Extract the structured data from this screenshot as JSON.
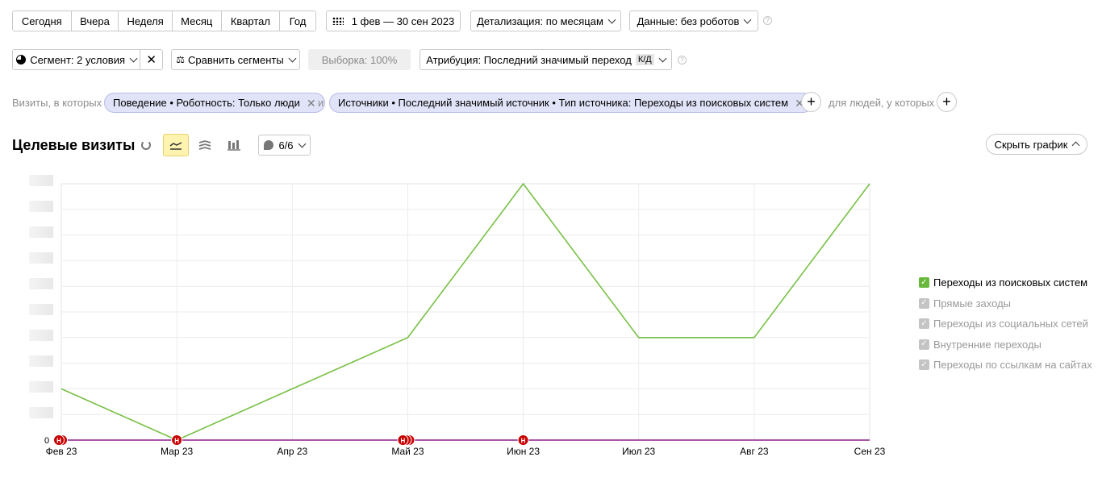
{
  "toolbar": {
    "periods": [
      "Сегодня",
      "Вчера",
      "Неделя",
      "Месяц",
      "Квартал",
      "Год"
    ],
    "date_range": "1 фев — 30 сен 2023",
    "detail": "Детализация: по месяцам",
    "data_filter": "Данные: без роботов",
    "help": "?"
  },
  "row2": {
    "segment": "Сегмент: 2 условия",
    "compare": "Сравнить сегменты",
    "sample": "Выборка: 100%",
    "attribution": "Атрибуция: Последний значимый переход",
    "attribution_badge": "К/Д"
  },
  "filters": {
    "prefix": "Визиты, в которых",
    "cond1": "Поведение • Роботность: Только люди",
    "joiner": "и",
    "cond2": "Источники • Последний значимый источник • Тип источника: Переходы из поисковых систем",
    "people": "для людей, у которых"
  },
  "chart_header": {
    "title": "Целевые визиты",
    "annotations": "6/6",
    "hide_chart": "Скрыть график"
  },
  "chart_data": {
    "type": "line",
    "x": [
      "Фев 23",
      "Мар 23",
      "Апр 23",
      "Май 23",
      "Июн 23",
      "Июл 23",
      "Авг 23",
      "Сен 23"
    ],
    "y_zero_label": "0",
    "series": [
      {
        "name": "Переходы из поисковых систем",
        "color": "#77c045",
        "values": [
          2,
          0,
          2,
          4,
          10,
          4,
          4,
          10
        ]
      }
    ],
    "ylim": [
      0,
      10
    ],
    "grid": true,
    "legend_position": "right",
    "event_markers": [
      "Фев 23",
      "Мар 23",
      "Май 23",
      "Июн 23"
    ],
    "event_marker_label": "Н"
  },
  "legend": [
    {
      "label": "Переходы из поисковых систем",
      "checked": true,
      "active": true
    },
    {
      "label": "Прямые заходы",
      "checked": true,
      "active": false
    },
    {
      "label": "Переходы из социальных сетей",
      "checked": true,
      "active": false
    },
    {
      "label": "Внутренние переходы",
      "checked": true,
      "active": false
    },
    {
      "label": "Переходы по ссылкам на сайтах",
      "checked": true,
      "active": false
    }
  ]
}
